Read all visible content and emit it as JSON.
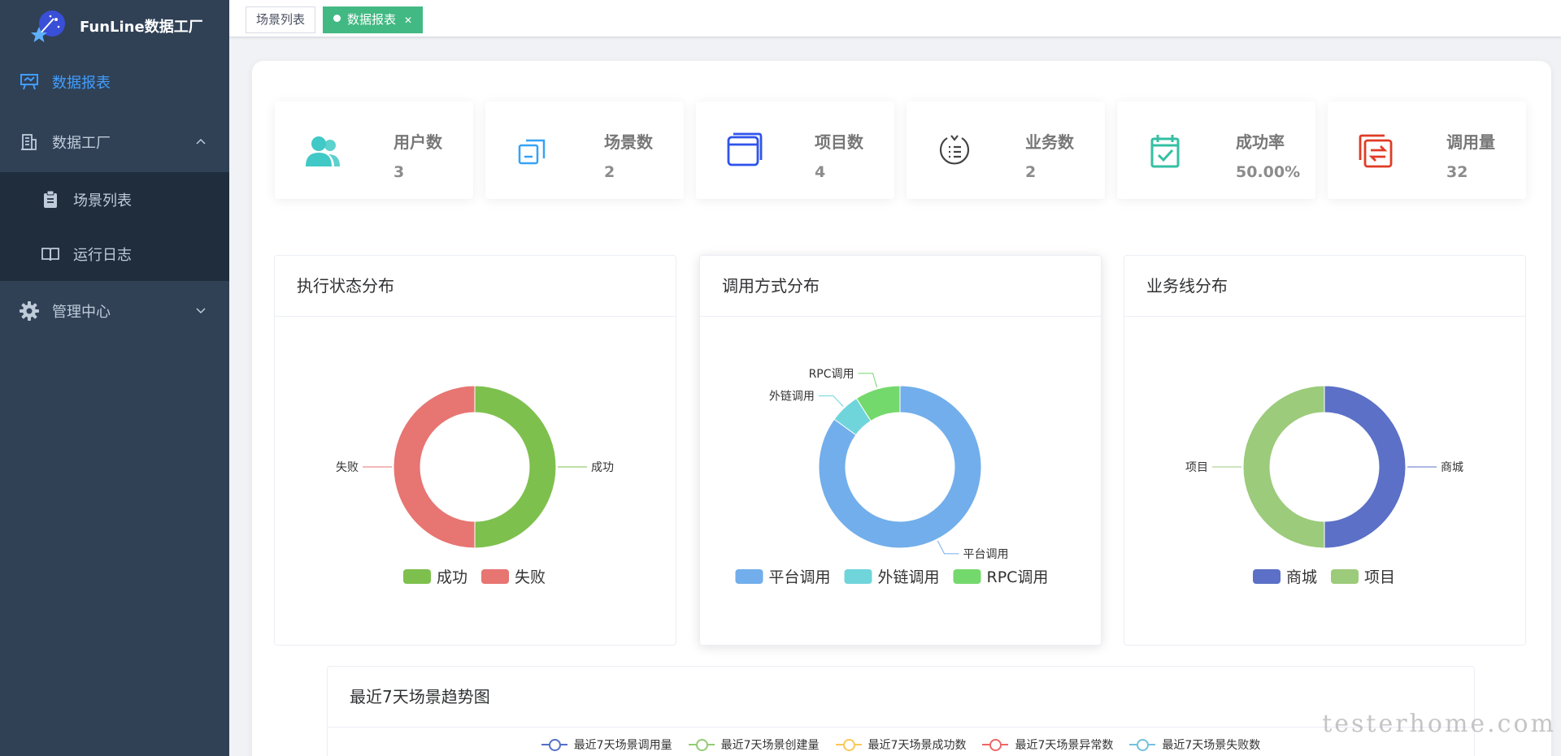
{
  "app": {
    "title": "FunLine数据工厂"
  },
  "sidebar": {
    "items": [
      {
        "label": "数据报表",
        "icon": "presentation-icon",
        "active": true
      },
      {
        "label": "数据工厂",
        "icon": "building-icon",
        "expanded": true,
        "children": [
          {
            "label": "场景列表",
            "icon": "clipboard-icon"
          },
          {
            "label": "运行日志",
            "icon": "book-icon"
          }
        ]
      },
      {
        "label": "管理中心",
        "icon": "gear-icon",
        "expanded": false
      }
    ]
  },
  "tags": [
    {
      "label": "场景列表",
      "active": false
    },
    {
      "label": "数据报表",
      "active": true
    }
  ],
  "stats": [
    {
      "label": "用户数",
      "value": "3",
      "icon": "users-icon",
      "color": "#40c9c6"
    },
    {
      "label": "场景数",
      "value": "2",
      "icon": "copy-icon",
      "color": "#36a3f7"
    },
    {
      "label": "项目数",
      "value": "4",
      "icon": "window-icon",
      "color": "#2f54eb"
    },
    {
      "label": "业务数",
      "value": "2",
      "icon": "list-circle-icon",
      "color": "#444444"
    },
    {
      "label": "成功率",
      "value": "50.00%",
      "icon": "calendar-check-icon",
      "color": "#34bfa3"
    },
    {
      "label": "调用量",
      "value": "32",
      "icon": "exchange-icon",
      "color": "#e03b25"
    }
  ],
  "cards": {
    "status": {
      "title": "执行状态分布"
    },
    "method": {
      "title": "调用方式分布"
    },
    "business": {
      "title": "业务线分布"
    },
    "trend": {
      "title": "最近7天场景趋势图"
    }
  },
  "chart_data": [
    {
      "type": "pie",
      "title": "执行状态分布",
      "categories": [
        "成功",
        "失败"
      ],
      "values": [
        50,
        50
      ],
      "colors": [
        "#7ec04e",
        "#e77572"
      ],
      "legend": "bottom"
    },
    {
      "type": "pie",
      "title": "调用方式分布",
      "categories": [
        "平台调用",
        "外链调用",
        "RPC调用"
      ],
      "values": [
        85,
        6,
        9
      ],
      "colors": [
        "#72aeeb",
        "#6fd5db",
        "#74d96c"
      ],
      "legend": "bottom"
    },
    {
      "type": "pie",
      "title": "业务线分布",
      "categories": [
        "商城",
        "项目"
      ],
      "values": [
        50,
        50
      ],
      "colors": [
        "#5b70c6",
        "#9ccb7b"
      ],
      "legend": "bottom"
    },
    {
      "type": "line",
      "title": "最近7天场景趋势图",
      "series": [
        {
          "name": "最近7天场景调用量",
          "color": "#5470c6"
        },
        {
          "name": "最近7天场景创建量",
          "color": "#91cc75"
        },
        {
          "name": "最近7天场景成功数",
          "color": "#fac858"
        },
        {
          "name": "最近7天场景异常数",
          "color": "#ee6666"
        },
        {
          "name": "最近7天场景失败数",
          "color": "#73c0de"
        }
      ]
    }
  ],
  "watermark": "testerhome.com"
}
